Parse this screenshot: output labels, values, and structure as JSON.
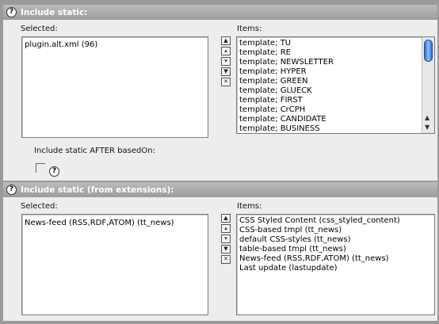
{
  "section1": {
    "title": "Include static:",
    "selected_label": "Selected:",
    "items_label": "Items:",
    "selected_items": [
      "plugin.alt.xml (96)"
    ],
    "available_items": [
      "template; TU",
      "template; RE",
      "template; NEWSLETTER",
      "template; HYPER",
      "template; GREEN",
      "template; GLUECK",
      "template; FIRST",
      "template; CrCPH",
      "template; CANDIDATE",
      "template; BUSINESS"
    ],
    "after_based_on_label": "Include static AFTER basedOn:"
  },
  "section2": {
    "title": "Include static (from extensions):",
    "selected_label": "Selected:",
    "items_label": "Items:",
    "selected_items": [
      "News-feed (RSS,RDF,ATOM) (tt_news)"
    ],
    "available_items": [
      "CSS Styled Content (css_styled_content)",
      "CSS-based tmpl (tt_news)",
      "default CSS-styles (tt_news)",
      "table-based tmpl (tt_news)",
      "News-feed (RSS,RDF,ATOM) (tt_news)",
      "Last update (lastupdate)"
    ]
  },
  "icons": {
    "help": "?",
    "move_top": "▲",
    "move_up": "▴",
    "move_down": "▾",
    "move_bottom": "▼",
    "remove": "✕"
  }
}
